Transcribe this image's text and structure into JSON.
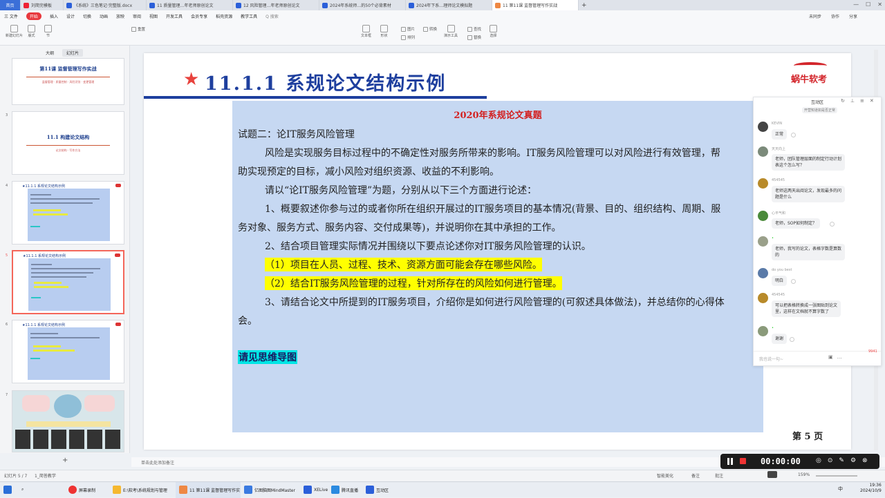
{
  "tabbar": {
    "home": "首页",
    "tabs": [
      {
        "label": "刘简完模板",
        "color": "#e23"
      },
      {
        "label": "《系统》三色笔记·完整版.docx",
        "color": "#2b5fd9"
      },
      {
        "label": "11 质量管理…年老师原创论文",
        "color": "#2b5fd9"
      },
      {
        "label": "12 风险管理…年老师原创论文",
        "color": "#2b5fd9"
      },
      {
        "label": "2024年系统师…的50个必背素材",
        "color": "#2b5fd9"
      },
      {
        "label": "2024年下系…理师论文模拟题",
        "color": "#2b5fd9"
      },
      {
        "label": "11 第11课 监督管理写作实战",
        "color": "#e84"
      }
    ],
    "add": "+"
  },
  "menubar": {
    "file": "三 文件",
    "items": [
      "开始",
      "插入",
      "设计",
      "切换",
      "动画",
      "放映",
      "审阅",
      "视图",
      "开发工具",
      "会员专享",
      "稻壳资源",
      "教学工具"
    ],
    "active": "开始",
    "search": "Q 搜索",
    "right": [
      "未同步",
      "协作",
      "分享"
    ]
  },
  "ribbon": {
    "groups": [
      "新建幻灯片",
      "版式",
      "节",
      "重置",
      "文本框",
      "形状",
      "排列",
      "演示工具",
      "查找",
      "替换",
      "选择"
    ],
    "small": [
      "图片",
      "排列",
      "转换",
      "格式刷",
      "粘贴",
      "剪切",
      "复制"
    ]
  },
  "leftpanel": {
    "tabs": [
      "大纲",
      "幻灯片"
    ],
    "slides": [
      {
        "num": "",
        "title": "第11课 监督管理写作实战",
        "sub": "监督管理 · 质量控制 · 风险识别 · 变更管理"
      },
      {
        "num": "3",
        "title": "11.1 构建论文结构",
        "sub": "论文结构 · 写作方法"
      },
      {
        "num": "4",
        "title": "★11.1.1 系规论文结构示例"
      },
      {
        "num": "5",
        "title": "★11.1.1 系规论文结构示例"
      },
      {
        "num": "6",
        "title": "★11.1.1 系规论文结构示例"
      },
      {
        "num": "7",
        "title": ""
      }
    ],
    "add": "+"
  },
  "slide": {
    "title_star": "★",
    "title": "11.1.1 系规论文结构示例",
    "logo": "蜗牛软考",
    "box_title": "2020年系规论文真题",
    "lines": [
      "试题二：论IT服务风险管理",
      "风险是实现服务目标过程中的不确定性对服务所带来的影响。IT服务风险管理可以对风险进行有效管理，帮",
      "助实现预定的目标，减小风险对组织资源、收益的不利影响。",
      "请以“论IT服务风险管理”为题，分别从以下三个方面进行论述：",
      "1、概要叙述你参与过的或者你所在组织开展过的IT服务项目的基本情况(背景、目的、组织结构、周期、服",
      "务对象、服务方式、服务内容、交付成果等)，并说明你在其中承担的工作。",
      "2、结合项目管理实际情况并围绕以下要点论述你对IT服务风险管理的认识。",
      "（1）项目在人员、过程、技术、资源方面可能会存在哪些风险。",
      "（2）结合IT服务风险管理的过程，针对所存在的风险如何进行管理。",
      "3、请结合论文中所提到的IT服务项目，介绍你是如何进行风险管理的(可叙述具体做法)，并总结你的心得体",
      "会。"
    ],
    "see_map": "请见思维导图",
    "page": "第 5 页"
  },
  "chat": {
    "title": "互动区",
    "top_partial": "开营知道如是否正常",
    "messages": [
      {
        "name": "KEVIN",
        "text": "正常",
        "color": "#444"
      },
      {
        "name": "天天向上",
        "text": "老师，团队管理层面的制定行动计划\n表这个怎么写？",
        "color": "#7b8a7a"
      },
      {
        "name": "454545",
        "text": "老师这两天出阅论文，发现最多的问\n题是什么",
        "color": "#b88a2a"
      },
      {
        "name": "心平气和",
        "text": "老师，SOP如何制定？",
        "color": "#4a8a3a"
      },
      {
        "name": "•",
        "text": "老师，我写的论文，表格字数是算数\n的",
        "color": "#9aa08a"
      },
      {
        "name": "do you best",
        "text": "明白",
        "color": "#5a7aa8"
      },
      {
        "name": "454545",
        "text": "可以把表格转换成一张图贴到论文\n里，这样在文档就不算字数了",
        "color": "#b88a2a"
      },
      {
        "name": "•",
        "text": "谢谢",
        "color": "#8a9a7a"
      }
    ],
    "input_placeholder": "我也说一句~",
    "badge": "9941"
  },
  "notes": {
    "placeholder": "单击此处添加备注"
  },
  "status": {
    "slide_info": "幻灯片 5 / 7",
    "theme": "1_简答教学",
    "smart": "智能美化",
    "notes": "备注",
    "comment": "批注",
    "zoom": "159%"
  },
  "recorder": {
    "time": "00:00:00"
  },
  "taskbar": {
    "apps": [
      {
        "label": "屏幕录制",
        "color": "#e33"
      },
      {
        "label": "E:\\软考\\系统规划与管理",
        "color": "#f5b830"
      },
      {
        "label": "11 第11课 监督管理写作实",
        "color": "#e84"
      },
      {
        "label": "亿图脑图MindMaster",
        "color": "#3a7ae0"
      },
      {
        "label": "XELive",
        "color": "#2b5fd9"
      },
      {
        "label": "腾讯直播",
        "color": "#2b8ae0"
      },
      {
        "label": "互动区",
        "color": "#2b5fd9"
      }
    ],
    "ime": "中",
    "time": "19:36",
    "date": "2024/10/9"
  }
}
